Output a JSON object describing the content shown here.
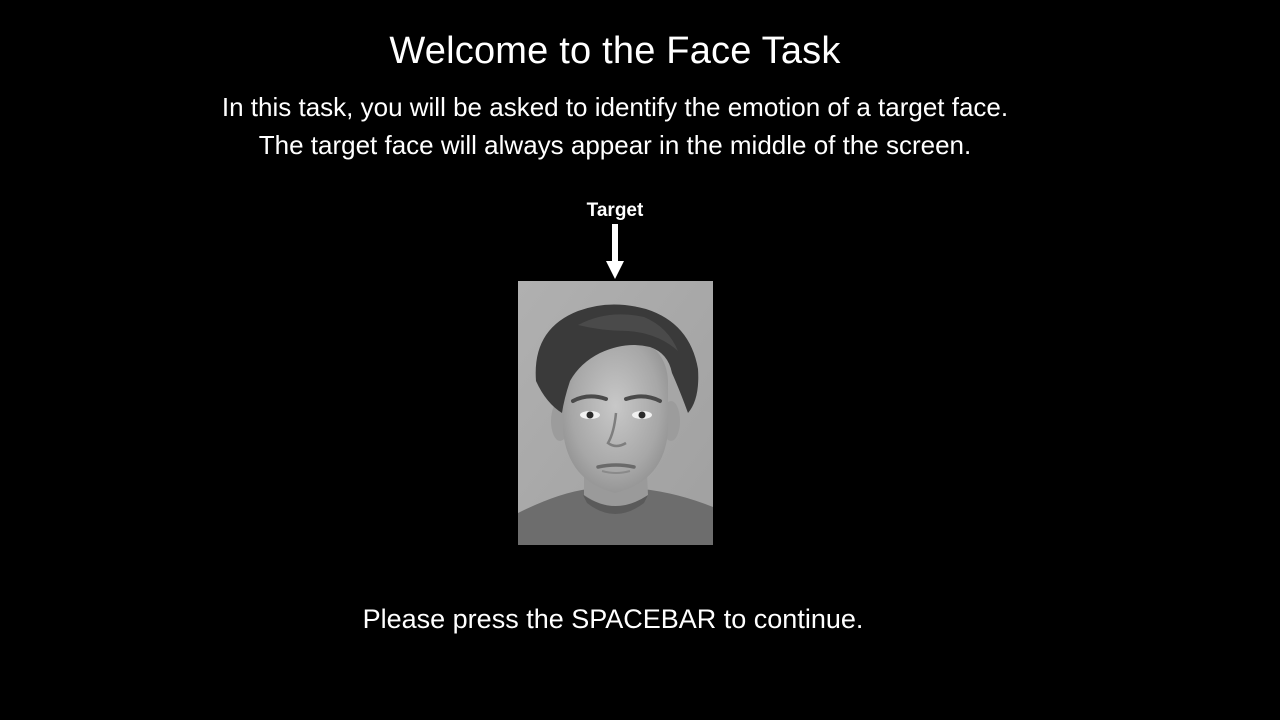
{
  "screen": {
    "title": "Welcome to the Face Task",
    "instructions": [
      "In this task, you will be asked to identify the emotion of a target face.",
      "The target face will always appear in the middle of the screen."
    ],
    "target_label": "Target",
    "continue_prompt": "Please press the SPACEBAR to continue."
  },
  "icons": {
    "arrow": "arrow-down-icon"
  },
  "colors": {
    "background": "#000000",
    "text": "#ffffff",
    "photo_background": "#a9a9a9"
  }
}
